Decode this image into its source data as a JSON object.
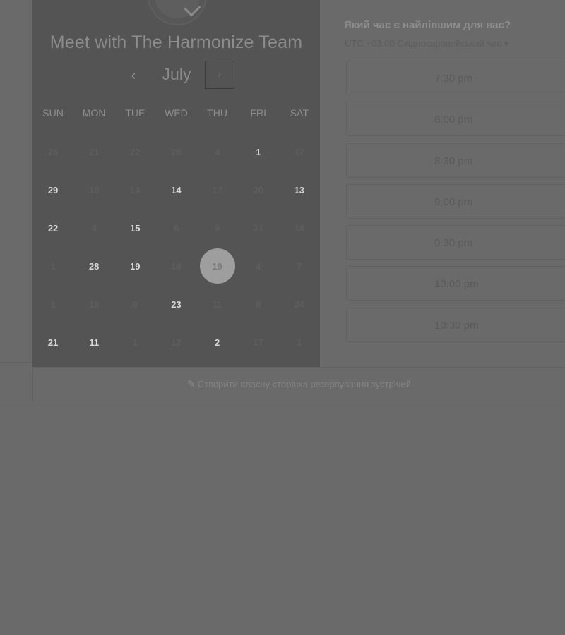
{
  "calendar": {
    "team_title": "Meet with The Harmonize Team",
    "month": "July",
    "prev_icon": "‹",
    "next_icon": "›",
    "weekdays": [
      "SUN",
      "MON",
      "TUE",
      "WED",
      "THU",
      "FRI",
      "SAT"
    ],
    "days": [
      {
        "label": "26",
        "available": false
      },
      {
        "label": "21",
        "available": false
      },
      {
        "label": "22",
        "available": false
      },
      {
        "label": "20",
        "available": false
      },
      {
        "label": "4",
        "available": false
      },
      {
        "label": "1",
        "available": true
      },
      {
        "label": "17",
        "available": false
      },
      {
        "label": "29",
        "available": true
      },
      {
        "label": "18",
        "available": false
      },
      {
        "label": "14",
        "available": false
      },
      {
        "label": "14",
        "available": true
      },
      {
        "label": "17",
        "available": false
      },
      {
        "label": "20",
        "available": false
      },
      {
        "label": "13",
        "available": true
      },
      {
        "label": "22",
        "available": true
      },
      {
        "label": "4",
        "available": false
      },
      {
        "label": "15",
        "available": true
      },
      {
        "label": "6",
        "available": false
      },
      {
        "label": "9",
        "available": false
      },
      {
        "label": "21",
        "available": false
      },
      {
        "label": "18",
        "available": false
      },
      {
        "label": "1",
        "available": false
      },
      {
        "label": "28",
        "available": true
      },
      {
        "label": "19",
        "available": true
      },
      {
        "label": "18",
        "available": false
      },
      {
        "label": "19",
        "available": true,
        "selected": true
      },
      {
        "label": "4",
        "available": false
      },
      {
        "label": "7",
        "available": false
      },
      {
        "label": "1",
        "available": false
      },
      {
        "label": "18",
        "available": false
      },
      {
        "label": "9",
        "available": false
      },
      {
        "label": "23",
        "available": true
      },
      {
        "label": "11",
        "available": false
      },
      {
        "label": "8",
        "available": false
      },
      {
        "label": "24",
        "available": false
      },
      {
        "label": "21",
        "available": true
      },
      {
        "label": "11",
        "available": true
      },
      {
        "label": "1",
        "available": false
      },
      {
        "label": "12",
        "available": false
      },
      {
        "label": "2",
        "available": true
      },
      {
        "label": "17",
        "available": false
      },
      {
        "label": "1",
        "available": false
      }
    ]
  },
  "time_panel": {
    "heading": "Який час є найліпшим для вас?",
    "timezone": "UTC +03:00 Східноєвропейський час ▾",
    "slots": [
      "7:30 pm",
      "8:00 pm",
      "8:30 pm",
      "9:00 pm",
      "9:30 pm",
      "10:00 pm",
      "10:30 pm"
    ]
  },
  "footer": {
    "icon": "✎",
    "link_text": "Створити власну сторінка резервування зустрічей"
  },
  "colors": {
    "overlay_background": "#6a6a6a",
    "calendar_panel": "#545454",
    "selected_day": "#9e9e9e"
  }
}
